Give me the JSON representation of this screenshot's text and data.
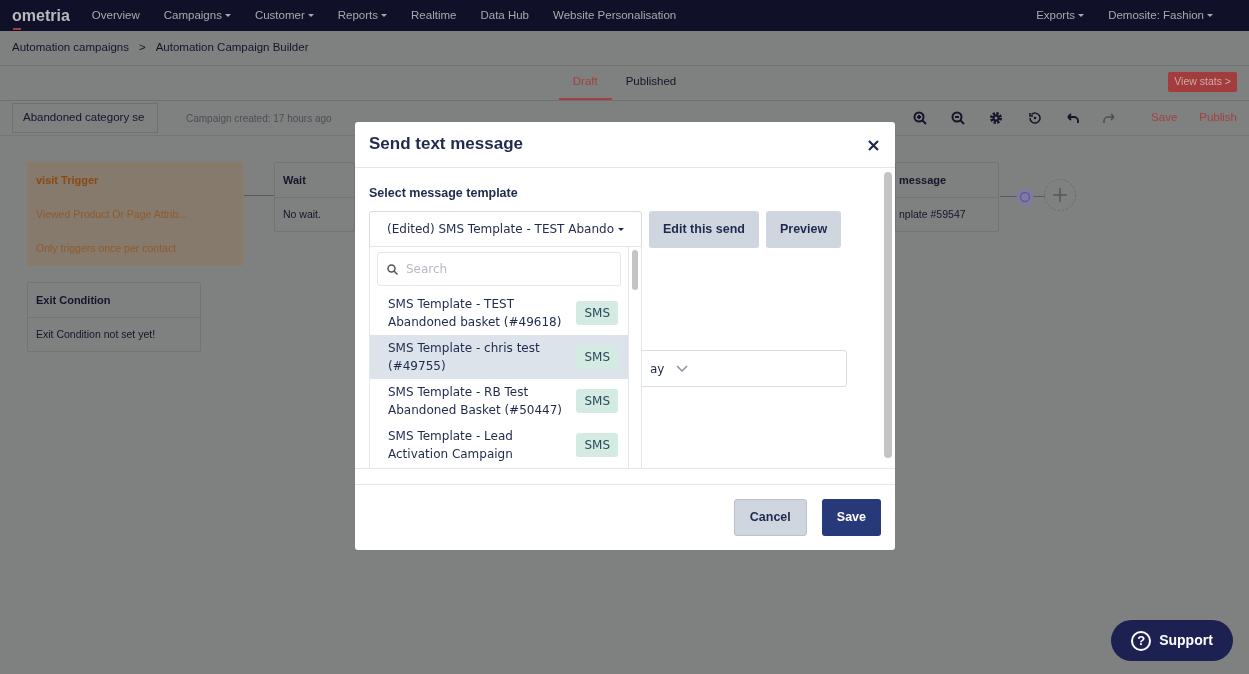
{
  "navbar": {
    "brand": "ometria",
    "items": [
      {
        "label": "Overview",
        "dropdown": false
      },
      {
        "label": "Campaigns",
        "dropdown": true
      },
      {
        "label": "Customer",
        "dropdown": true
      },
      {
        "label": "Reports",
        "dropdown": true
      },
      {
        "label": "Realtime",
        "dropdown": false
      },
      {
        "label": "Data Hub",
        "dropdown": false
      },
      {
        "label": "Website Personalisation",
        "dropdown": false
      }
    ],
    "right_items": [
      {
        "label": "Exports",
        "dropdown": true
      },
      {
        "label": "Demosite: Fashion",
        "dropdown": true
      }
    ]
  },
  "breadcrumb": [
    "Automation campaigns",
    ">",
    "Automation Campaign Builder"
  ],
  "tabs": [
    {
      "label": "Draft",
      "selected": true
    },
    {
      "label": "Published",
      "selected": false
    }
  ],
  "view_stats": "View stats >",
  "toolbar": {
    "campaign_name": "Abandoned category se",
    "created": "Campaign created: 17 hours ago",
    "actions": [
      "Save",
      "Publish"
    ]
  },
  "canvas": {
    "nodes": [
      {
        "kind": "trigger",
        "title": "visit Trigger",
        "lines": [
          "Viewed Product Or Page Attrib...",
          "Only triggers once per contact"
        ]
      },
      {
        "kind": "step",
        "title": "Wait",
        "lines": [
          "No wait."
        ]
      },
      {
        "kind": "step",
        "title": "message",
        "lines": [
          "nplate #59547"
        ]
      },
      {
        "kind": "step",
        "title": "Exit Condition",
        "lines": [
          "Exit Condition not set yet!"
        ]
      }
    ]
  },
  "modal": {
    "title": "Send text message",
    "label": "Select message template",
    "select_value": "(Edited) SMS Template - TEST Abando",
    "buttons": [
      "Edit this send",
      "Preview"
    ],
    "dropdown": {
      "placeholder": "Search",
      "options": [
        {
          "label": "SMS Template - TEST Abandoned basket (#49618)",
          "tag": "SMS",
          "selected": false
        },
        {
          "label": "SMS Template - chris test (#49755)",
          "tag": "SMS",
          "selected": true
        },
        {
          "label": "SMS Template - RB Test Abandoned Basket (#50447)",
          "tag": "SMS",
          "selected": false
        },
        {
          "label": "SMS Template - Lead Activation Campaign",
          "tag": "SMS",
          "selected": false
        }
      ]
    },
    "delay_value": "ay",
    "footer_buttons": [
      {
        "label": "Cancel",
        "kind": "secondary"
      },
      {
        "label": "Save",
        "kind": "primary"
      }
    ]
  },
  "support": {
    "icon": "?",
    "label": "Support"
  }
}
